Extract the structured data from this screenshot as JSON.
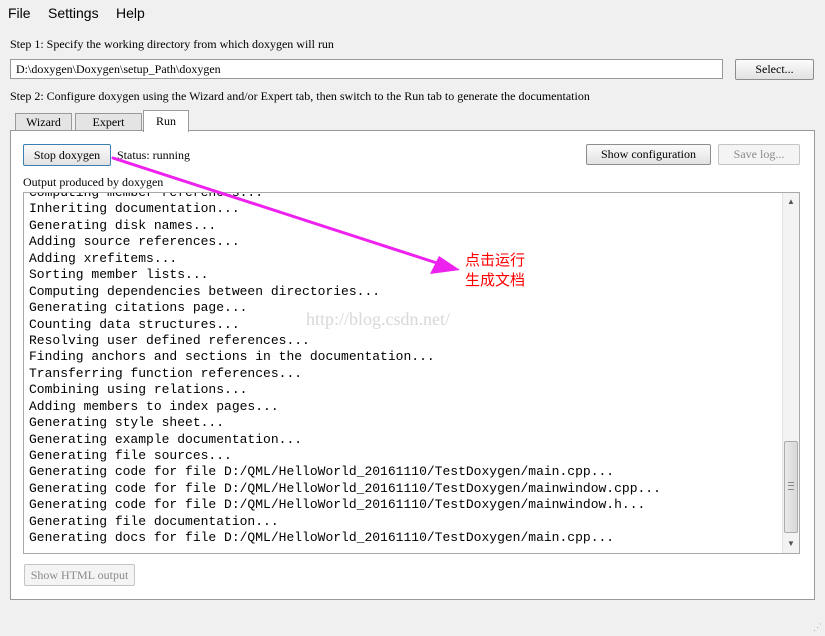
{
  "menu": {
    "file": "File",
    "settings": "Settings",
    "help": "Help"
  },
  "step1": {
    "label": "Step 1: Specify the working directory from which doxygen will run",
    "path": "D:\\doxygen\\Doxygen\\setup_Path\\doxygen",
    "select_button": "Select..."
  },
  "step2": {
    "label": "Step 2: Configure doxygen using the Wizard and/or Expert tab, then switch to the Run tab to generate the documentation"
  },
  "tabs": [
    "Wizard",
    "Expert",
    "Run"
  ],
  "active_tab": "Run",
  "run": {
    "stop_button": "Stop doxygen",
    "status": "Status: running",
    "show_configuration_button": "Show configuration",
    "save_log_button": "Save log...",
    "output_label": "Output produced by doxygen",
    "show_html_button": "Show HTML output"
  },
  "log_lines": [
    "Computing member references...",
    "Inheriting documentation...",
    "Generating disk names...",
    "Adding source references...",
    "Adding xrefitems...",
    "Sorting member lists...",
    "Computing dependencies between directories...",
    "Generating citations page...",
    "Counting data structures...",
    "Resolving user defined references...",
    "Finding anchors and sections in the documentation...",
    "Transferring function references...",
    "Combining using relations...",
    "Adding members to index pages...",
    "Generating style sheet...",
    "Generating example documentation...",
    "Generating file sources...",
    "Generating code for file D:/QML/HelloWorld_20161110/TestDoxygen/main.cpp...",
    "Generating code for file D:/QML/HelloWorld_20161110/TestDoxygen/mainwindow.cpp...",
    "Generating code for file D:/QML/HelloWorld_20161110/TestDoxygen/mainwindow.h...",
    "Generating file documentation...",
    "Generating docs for file D:/QML/HelloWorld_20161110/TestDoxygen/main.cpp..."
  ],
  "annotation": "点击运行\n生成文档",
  "watermark": "http://blog.csdn.net/",
  "colors": {
    "annotation": "#ff0000",
    "arrow": "#ee22ee"
  }
}
